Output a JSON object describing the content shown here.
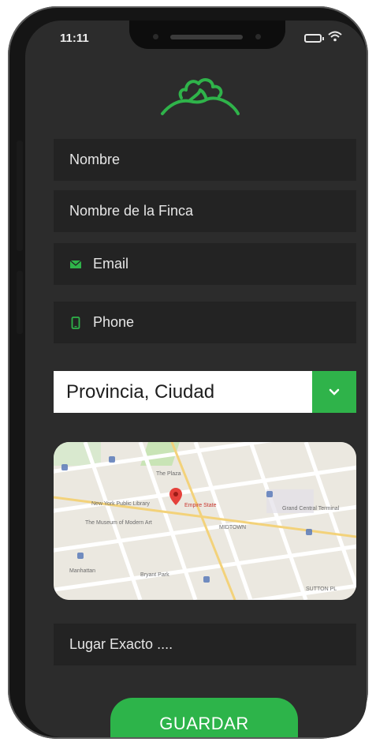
{
  "status_bar": {
    "time": "11:11"
  },
  "form": {
    "nombre_placeholder": "Nombre",
    "finca_placeholder": "Nombre de la Finca",
    "email_placeholder": "Email",
    "phone_placeholder": "Phone",
    "location_select_value": "Provincia, Ciudad",
    "lugar_placeholder": "Lugar Exacto ...."
  },
  "map": {
    "marker_label": "Empire State",
    "labels": [
      "The Plaza",
      "New York Public Library",
      "The Museum of Modern Art",
      "Grand Central Terminal",
      "Bryant Park",
      "Manhattan",
      "MIDTOWN",
      "SUTTON PL"
    ]
  },
  "actions": {
    "save_label": "GUARDAR"
  },
  "colors": {
    "accent": "#2db44a",
    "field_bg": "#232323",
    "screen_bg": "#2c2c2c"
  },
  "icons": [
    "leaf-logo-icon",
    "email-icon",
    "phone-icon",
    "chevron-down-icon",
    "map-pin-icon",
    "battery-icon",
    "wifi-icon"
  ]
}
